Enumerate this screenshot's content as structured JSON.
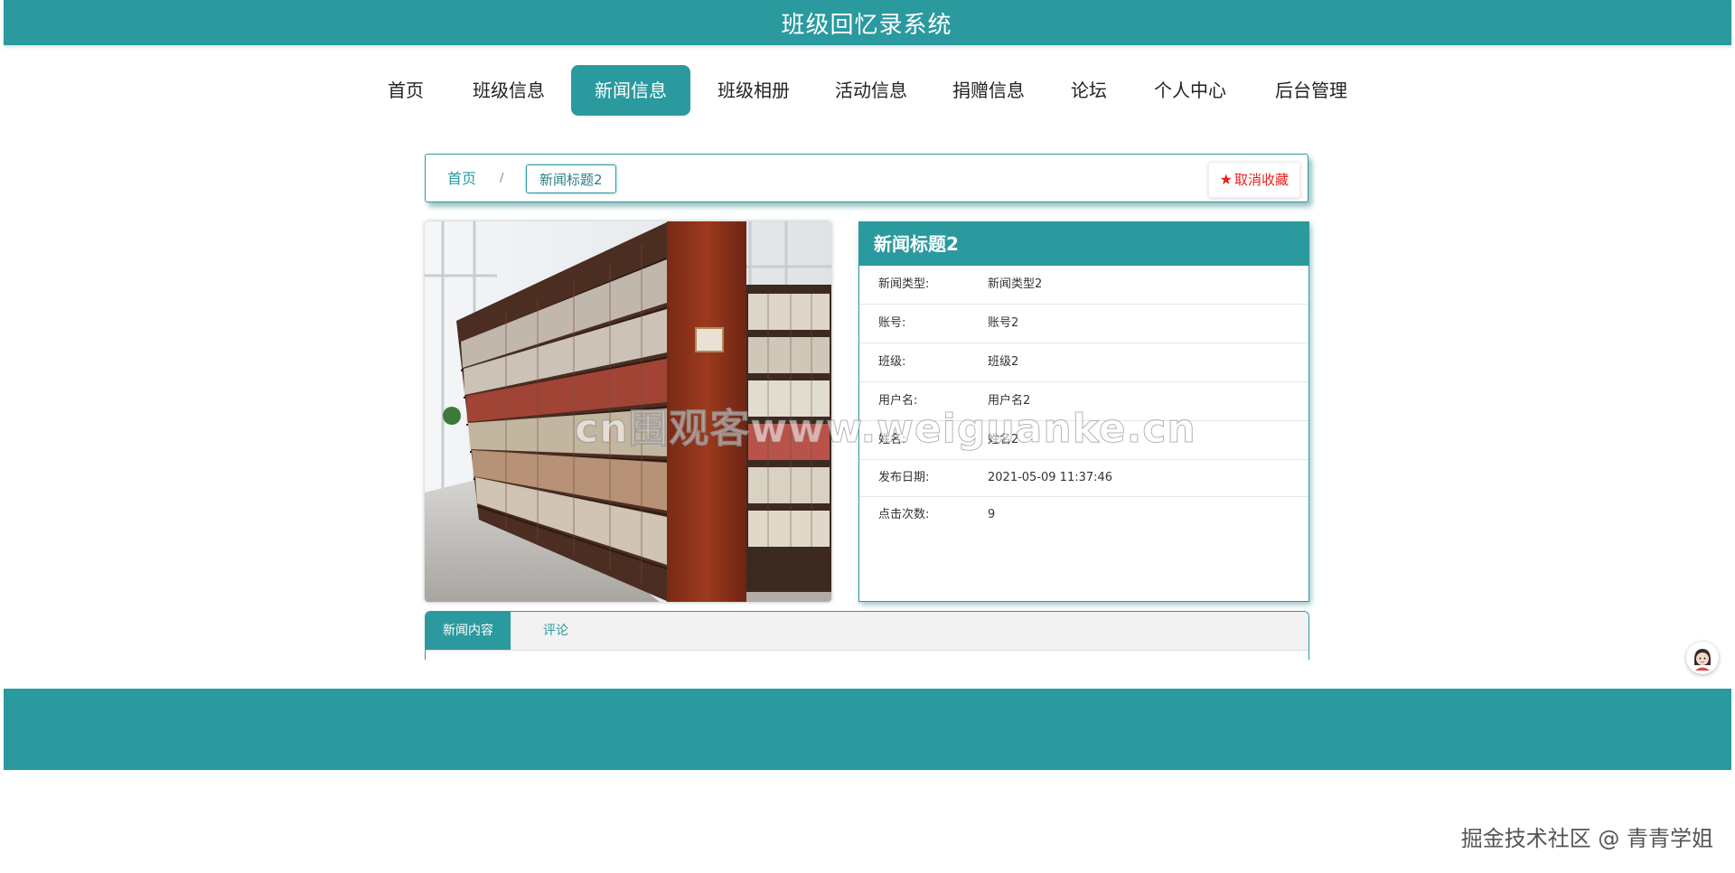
{
  "header": {
    "title": "班级回忆录系统"
  },
  "nav": {
    "items": [
      {
        "label": "首页"
      },
      {
        "label": "班级信息"
      },
      {
        "label": "新闻信息"
      },
      {
        "label": "班级相册"
      },
      {
        "label": "活动信息"
      },
      {
        "label": "捐赠信息"
      },
      {
        "label": "论坛"
      },
      {
        "label": "个人中心"
      },
      {
        "label": "后台管理"
      }
    ],
    "active_index": 2
  },
  "breadcrumb": {
    "home": "首页",
    "separator": "/",
    "current": "新闻标题2"
  },
  "favorite": {
    "icon": "star-icon",
    "star": "★",
    "label": "取消收藏"
  },
  "detail": {
    "title": "新闻标题2",
    "rows": [
      {
        "key": "新闻类型:",
        "value": "新闻类型2"
      },
      {
        "key": "账号:",
        "value": "账号2"
      },
      {
        "key": "班级:",
        "value": "班级2"
      },
      {
        "key": "用户名:",
        "value": "用户名2"
      },
      {
        "key": "姓名:",
        "value": "姓名2"
      },
      {
        "key": "发布日期:",
        "value": "2021-05-09 11:37:46"
      },
      {
        "key": "点击次数:",
        "value": "9"
      }
    ]
  },
  "tabs": {
    "items": [
      {
        "label": "新闻内容"
      },
      {
        "label": "评论"
      }
    ],
    "active_index": 0
  },
  "watermarks": {
    "center": "cn围观客www.weiguanke.cn",
    "bottom": "掘金技术社区 @ 青青学姐"
  },
  "colors": {
    "primary": "#2a9a9f",
    "favorite": "#e62020"
  }
}
